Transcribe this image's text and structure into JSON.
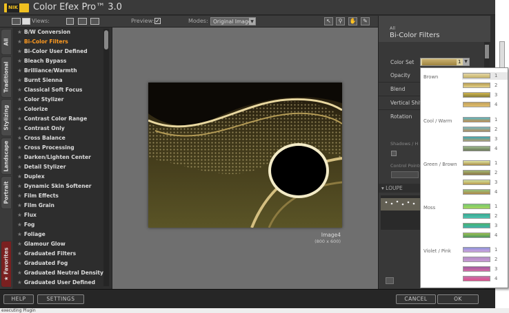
{
  "app": {
    "title": "Color Efex Pro™ 3.0",
    "logo_text": "NIK"
  },
  "toolbar": {
    "views_label": "Views:",
    "preview_label": "Preview:",
    "preview_checked": "✓",
    "modes_label": "Modes:",
    "modes_value": "Original Image"
  },
  "tabs": [
    "All",
    "Traditional",
    "Stylizing",
    "Landscape",
    "Portrait",
    "Favorites"
  ],
  "filters": [
    "B/W Conversion",
    "Bi-Color Filters",
    "Bi-Color User Defined",
    "Bleach Bypass",
    "Brilliance/Warmth",
    "Burnt Sienna",
    "Classical Soft Focus",
    "Color Stylizer",
    "Colorize",
    "Contrast Color Range",
    "Contrast Only",
    "Cross Balance",
    "Cross Processing",
    "Darken/Lighten Center",
    "Detail Stylizer",
    "Duplex",
    "Dynamic Skin Softener",
    "Film Effects",
    "Film Grain",
    "Flux",
    "Fog",
    "Foliage",
    "Glamour Glow",
    "Graduated Filters",
    "Graduated Fog",
    "Graduated Neutral Density",
    "Graduated User Defined"
  ],
  "active_filter_index": 1,
  "image": {
    "name": "Image4",
    "size": "(800 x 600)"
  },
  "panel": {
    "all": "All",
    "title": "Bi-Color Filters",
    "color_set_label": "Color Set",
    "color_set_value": "1",
    "opacity_label": "Opacity",
    "blend_label": "Blend",
    "vertical_shift_label": "Vertical Shift",
    "rotation_label": "Rotation",
    "shadows_label": "Shadows / H",
    "control_points_label": "Control Points",
    "loupe_label": "LOUPE"
  },
  "dropdown": {
    "groups": [
      {
        "name": "Brown",
        "swatches": [
          [
            "1",
            "#e4d7a6",
            "#c7b469"
          ],
          [
            "2",
            "#b79d52",
            "#e4d18a"
          ],
          [
            "3",
            "#d1b64e",
            "#887e3a"
          ],
          [
            "4",
            "#c0a05c",
            "#e1be6e"
          ]
        ]
      },
      {
        "name": "Cool / Warm",
        "swatches": [
          [
            "1",
            "#5ab7c7",
            "#c68e4b"
          ],
          [
            "2",
            "#77b8c0",
            "#b28e5e"
          ],
          [
            "3",
            "#3fa7b3",
            "#b29e72"
          ],
          [
            "4",
            "#9cb88b",
            "#6a7858"
          ]
        ]
      },
      {
        "name": "Green / Brown",
        "swatches": [
          [
            "1",
            "#e3e7a3",
            "#a88c48"
          ],
          [
            "2",
            "#a2b875",
            "#8c7444"
          ],
          [
            "3",
            "#d1e19d",
            "#ba9b4e"
          ],
          [
            "4",
            "#96c27a",
            "#b0884a"
          ]
        ]
      },
      {
        "name": "Moss",
        "swatches": [
          [
            "1",
            "#76c871",
            "#a7d65a"
          ],
          [
            "2",
            "#39a68e",
            "#4ec4b2"
          ],
          [
            "3",
            "#49b36c",
            "#3fb1b2"
          ],
          [
            "4",
            "#9dc251",
            "#4e9460"
          ]
        ]
      },
      {
        "name": "Violet / Pink",
        "swatches": [
          [
            "1",
            "#8a93d7",
            "#d1a3e0"
          ],
          [
            "2",
            "#b18cc4",
            "#c99ad5"
          ],
          [
            "3",
            "#9c5c9e",
            "#d76aa4"
          ],
          [
            "4",
            "#c471a8",
            "#e04e8d"
          ]
        ]
      }
    ]
  },
  "buttons": {
    "help": "HELP",
    "settings": "SETTINGS",
    "cancel": "CANCEL",
    "ok": "OK"
  },
  "status": {
    "text": "executing Plugin"
  }
}
